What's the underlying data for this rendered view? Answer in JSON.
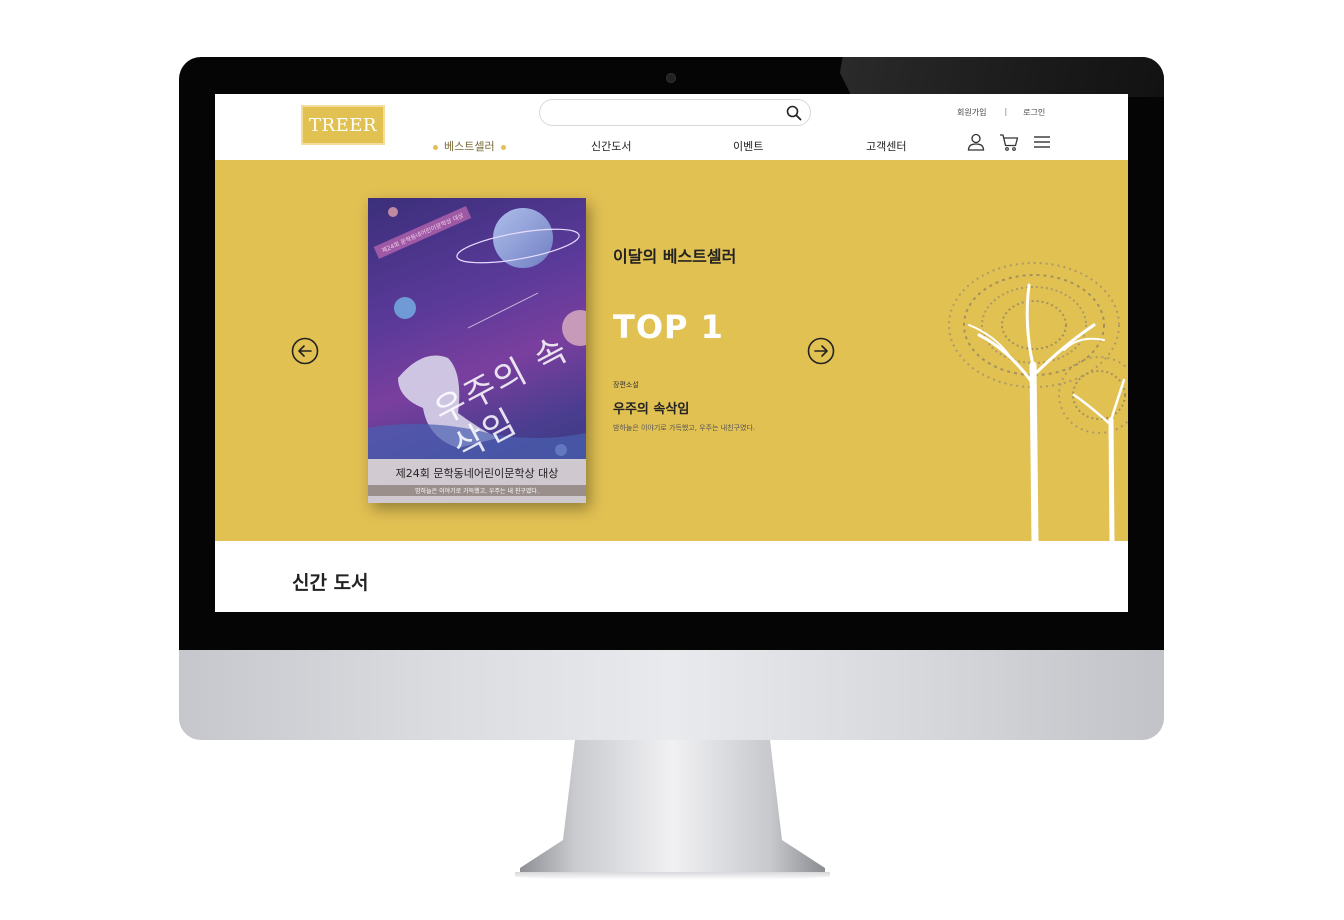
{
  "header": {
    "logo": "TREER",
    "search": {
      "placeholder": ""
    },
    "auth": {
      "signup": "회원가입",
      "separator": "|",
      "login": "로그인"
    },
    "nav": [
      {
        "label": "베스트셀러",
        "active": true
      },
      {
        "label": "신간도서",
        "active": false
      },
      {
        "label": "이벤트",
        "active": false
      },
      {
        "label": "고객센터",
        "active": false
      }
    ],
    "icons": [
      "user-icon",
      "cart-icon",
      "menu-icon"
    ]
  },
  "banner": {
    "label": "이달의 베스트셀러",
    "rank": "TOP 1",
    "genre": "장편소설",
    "title": "우주의 속삭임",
    "description": "밤하늘은 이야기로 가득했고, 우주는 내친구였다.",
    "book_cover": {
      "title": "우주의 속삭임",
      "stamp": "제24회 문학동네어린이문학상 대상",
      "award": "제24회 문학동네어린이문학상 대상",
      "tagline": "밤하늘은 이야기로 가득했고, 우주는 내 친구였다."
    },
    "prev_icon": "arrow-left-circle-icon",
    "next_icon": "arrow-right-circle-icon"
  },
  "section": {
    "title": "신간 도서"
  },
  "colors": {
    "accent": "#e2c153",
    "text": "#222222",
    "bezel": "#050505"
  }
}
